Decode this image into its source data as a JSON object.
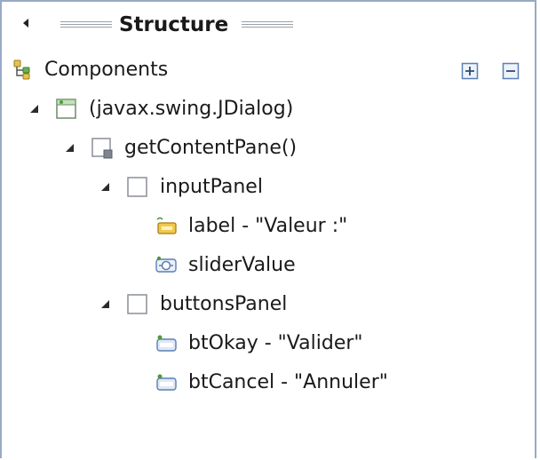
{
  "view": {
    "title": "Structure",
    "header_label": "Components"
  },
  "tree": {
    "nodes": [
      {
        "label": "(javax.swing.JDialog)",
        "icon": "jdialog-icon",
        "expanded": true
      },
      {
        "label": "getContentPane()",
        "icon": "content-pane-icon",
        "expanded": true
      },
      {
        "label": "inputPanel",
        "icon": "panel-icon",
        "expanded": true
      },
      {
        "label": "label - \"Valeur :\"",
        "icon": "jlabel-icon"
      },
      {
        "label": "sliderValue",
        "icon": "jslider-icon"
      },
      {
        "label": "buttonsPanel",
        "icon": "panel-icon",
        "expanded": true
      },
      {
        "label": "btOkay - \"Valider\"",
        "icon": "jbutton-icon"
      },
      {
        "label": "btCancel - \"Annuler\"",
        "icon": "jbutton-icon"
      }
    ]
  },
  "colors": {
    "border": "#98a9c4",
    "icon_green": "#4c9a3d",
    "icon_blue": "#5b7fb3"
  }
}
